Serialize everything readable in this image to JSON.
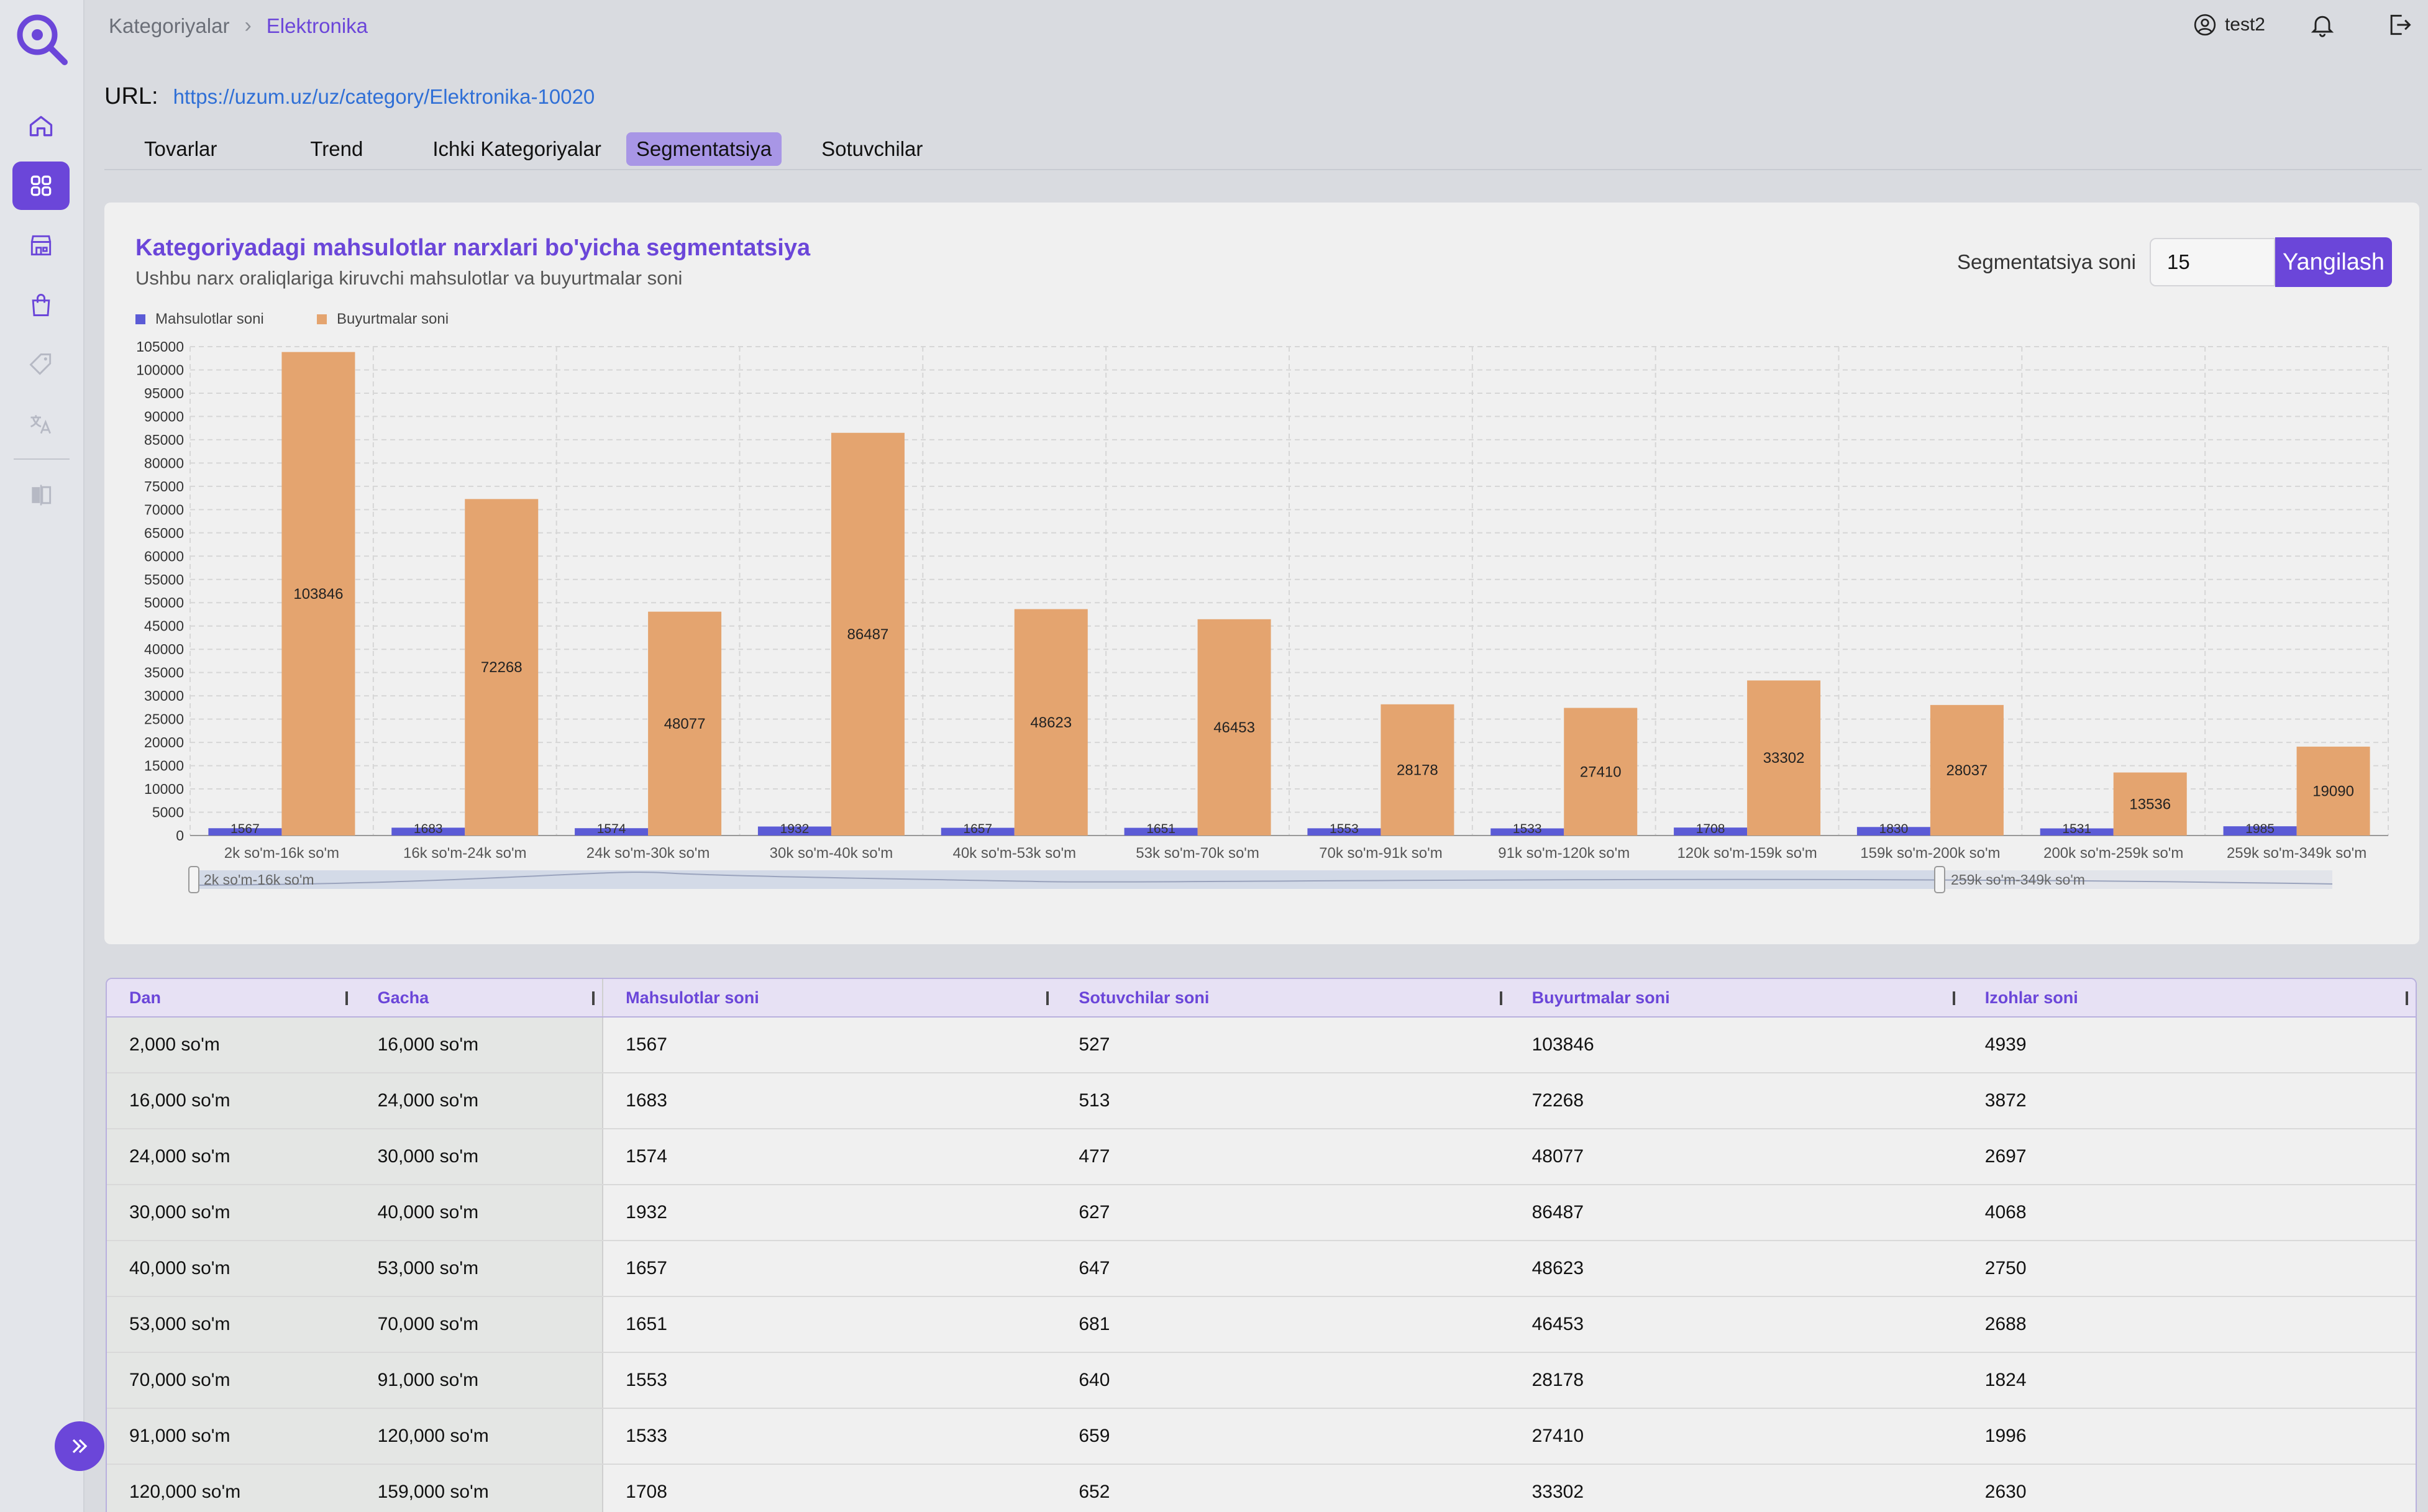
{
  "breadcrumb": {
    "parent": "Kategoriyalar",
    "current": "Elektronika"
  },
  "user": {
    "name": "test2"
  },
  "url": {
    "label": "URL:",
    "link": "https://uzum.uz/uz/category/Elektronika-10020"
  },
  "tabs": [
    {
      "label": "Tovarlar",
      "active": false
    },
    {
      "label": "Trend",
      "active": false
    },
    {
      "label": "Ichki Kategoriyalar",
      "active": false
    },
    {
      "label": "Segmentatsiya",
      "active": true
    },
    {
      "label": "Sotuvchilar",
      "active": false
    }
  ],
  "card": {
    "title": "Kategoriyadagi mahsulotlar narxlari bo'yicha segmentatsiya",
    "subtitle": "Ushbu narx oraliqlariga kiruvchi mahsulotlar va buyurtmalar soni",
    "seg_label": "Segmentatsiya soni",
    "seg_value": "15",
    "seg_button": "Yangilash",
    "zoom_start_label": "2k so'm-16k so'm",
    "zoom_end_label": "259k so'm-349k so'm"
  },
  "colors": {
    "accent": "#6b46d9",
    "series_products": "#5b5bd6",
    "series_orders": "#e4a46f"
  },
  "chart_data": {
    "type": "bar",
    "categories": [
      "2k so'm-16k so'm",
      "16k so'm-24k so'm",
      "24k so'm-30k so'm",
      "30k so'm-40k so'm",
      "40k so'm-53k so'm",
      "53k so'm-70k so'm",
      "70k so'm-91k so'm",
      "91k so'm-120k so'm",
      "120k so'm-159k so'm",
      "159k so'm-200k so'm",
      "200k so'm-259k so'm",
      "259k so'm-349k so'm"
    ],
    "series": [
      {
        "name": "Mahsulotlar soni",
        "values": [
          1567,
          1683,
          1574,
          1932,
          1657,
          1651,
          1553,
          1533,
          1708,
          1830,
          1531,
          1985
        ]
      },
      {
        "name": "Buyurtmalar soni",
        "values": [
          103846,
          72268,
          48077,
          86487,
          48623,
          46453,
          28178,
          27410,
          33302,
          28037,
          13536,
          19090
        ]
      }
    ],
    "ylim": [
      0,
      105000
    ],
    "yticks": [
      0,
      5000,
      10000,
      15000,
      20000,
      25000,
      30000,
      35000,
      40000,
      45000,
      50000,
      55000,
      60000,
      65000,
      70000,
      75000,
      80000,
      85000,
      90000,
      95000,
      100000,
      105000
    ],
    "legend": "top-left",
    "grid": true
  },
  "table": {
    "headers": {
      "dan": "Dan",
      "gacha": "Gacha",
      "products": "Mahsulotlar soni",
      "sellers": "Sotuvchilar soni",
      "orders": "Buyurtmalar soni",
      "reviews": "Izohlar soni"
    },
    "rows": [
      {
        "dan": "2,000 so'm",
        "gacha": "16,000 so'm",
        "products": "1567",
        "sellers": "527",
        "orders": "103846",
        "reviews": "4939"
      },
      {
        "dan": "16,000 so'm",
        "gacha": "24,000 so'm",
        "products": "1683",
        "sellers": "513",
        "orders": "72268",
        "reviews": "3872"
      },
      {
        "dan": "24,000 so'm",
        "gacha": "30,000 so'm",
        "products": "1574",
        "sellers": "477",
        "orders": "48077",
        "reviews": "2697"
      },
      {
        "dan": "30,000 so'm",
        "gacha": "40,000 so'm",
        "products": "1932",
        "sellers": "627",
        "orders": "86487",
        "reviews": "4068"
      },
      {
        "dan": "40,000 so'm",
        "gacha": "53,000 so'm",
        "products": "1657",
        "sellers": "647",
        "orders": "48623",
        "reviews": "2750"
      },
      {
        "dan": "53,000 so'm",
        "gacha": "70,000 so'm",
        "products": "1651",
        "sellers": "681",
        "orders": "46453",
        "reviews": "2688"
      },
      {
        "dan": "70,000 so'm",
        "gacha": "91,000 so'm",
        "products": "1553",
        "sellers": "640",
        "orders": "28178",
        "reviews": "1824"
      },
      {
        "dan": "91,000 so'm",
        "gacha": "120,000 so'm",
        "products": "1533",
        "sellers": "659",
        "orders": "27410",
        "reviews": "1996"
      },
      {
        "dan": "120,000 so'm",
        "gacha": "159,000 so'm",
        "products": "1708",
        "sellers": "652",
        "orders": "33302",
        "reviews": "2630"
      }
    ]
  },
  "icons": [
    "logo-search-icon",
    "home-icon",
    "grid-icon",
    "store-icon",
    "bag-icon",
    "tag-icon",
    "translate-icon",
    "compare-icon",
    "user-icon",
    "bell-icon",
    "logout-icon",
    "chevron-right-icon",
    "double-chevron-right-icon"
  ]
}
